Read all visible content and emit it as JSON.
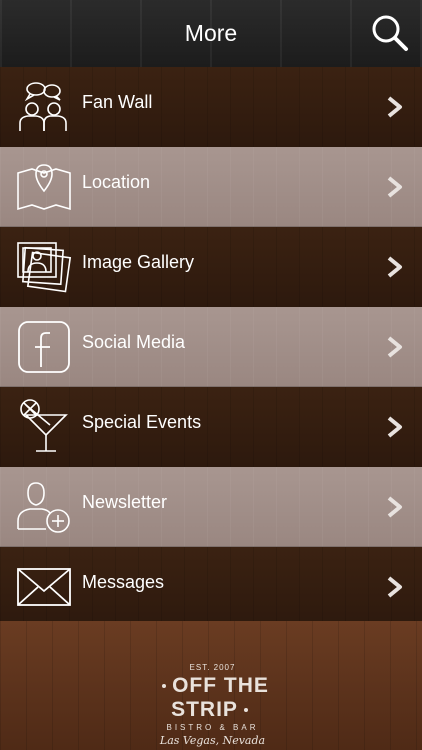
{
  "header": {
    "title": "More",
    "search_icon": "search-icon"
  },
  "menu": [
    {
      "label": "Fan Wall",
      "icon": "users-chat-icon"
    },
    {
      "label": "Location",
      "icon": "map-pin-icon"
    },
    {
      "label": "Image Gallery",
      "icon": "photo-stack-icon"
    },
    {
      "label": "Social Media",
      "icon": "facebook-icon"
    },
    {
      "label": "Special Events",
      "icon": "cocktail-icon"
    },
    {
      "label": "Newsletter",
      "icon": "add-user-icon"
    },
    {
      "label": "Messages",
      "icon": "envelope-icon"
    }
  ],
  "footer": {
    "logo": {
      "est": "EST. 2007",
      "name": "OFF THE STRIP",
      "sub": "BISTRO & BAR",
      "city": "Las Vegas, Nevada"
    }
  }
}
